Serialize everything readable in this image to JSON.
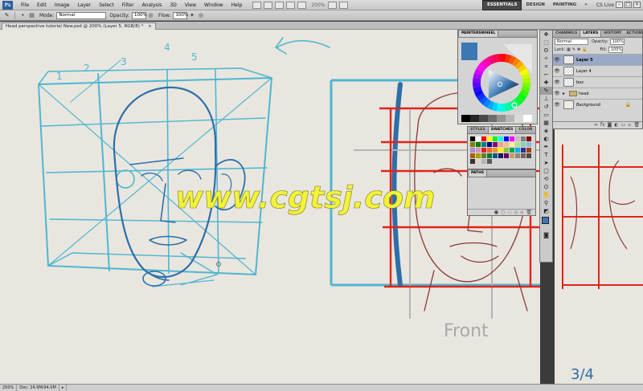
{
  "app": {
    "logo": "Ps",
    "menus": [
      "File",
      "Edit",
      "Image",
      "Layer",
      "Select",
      "Filter",
      "Analysis",
      "3D",
      "View",
      "Window",
      "Help"
    ],
    "zoom": "200%",
    "workspaces": [
      "ESSENTIALS",
      "DESIGN",
      "PAINTING"
    ],
    "cs_live": "CS Live"
  },
  "options": {
    "mode_label": "Mode:",
    "mode_value": "Normal",
    "opacity_label": "Opacity:",
    "opacity_value": "100%",
    "flow_label": "Flow:",
    "flow_value": "100%"
  },
  "document": {
    "tab_title": "Head perspective tutorial New.psd @ 200% (Layer 5, RGB/8) *"
  },
  "canvas_text": {
    "watermark": "www.cgtsj.com",
    "front_label": "Front",
    "three_q_label": "3/4",
    "num_1": "1",
    "num_2": "2",
    "num_3": "3",
    "num_4": "4",
    "num_5": "5"
  },
  "status": {
    "zoom": "200%",
    "doc_size": "Doc: 24.9M/94.0M"
  },
  "painter_panel": {
    "tab": "PAINTERSWHEEL",
    "accent_color": "#3c78b4"
  },
  "swatch_panel": {
    "tabs": [
      "STYLES",
      "SWATCHES",
      "COLOR"
    ],
    "active_tab": "SWATCHES",
    "colors": [
      "#000000",
      "#ffffff",
      "#ff0000",
      "#ffff00",
      "#00ff00",
      "#00ffff",
      "#0000ff",
      "#ff00ff",
      "#c0c0c0",
      "#808080",
      "#800000",
      "#808000",
      "#008000",
      "#008080",
      "#000080",
      "#800080",
      "#f3a08a",
      "#f7c08a",
      "#fff09a",
      "#b8e08a",
      "#8ad0b8",
      "#8ab8e0",
      "#a890d0",
      "#e090c0",
      "#ed1c24",
      "#f26522",
      "#f7941d",
      "#fff200",
      "#8dc63f",
      "#00a651",
      "#00aeef",
      "#2e3192",
      "#a0410d",
      "#a36209",
      "#aba000",
      "#598527",
      "#007236",
      "#005b7f",
      "#1b1464",
      "#630460",
      "#c69c6d",
      "#998675",
      "#736357",
      "#534741",
      "#362f2d",
      "#e0d4c4",
      "#b4b4b4",
      "#5a5a5a"
    ]
  },
  "paths_panel": {
    "tab": "PATHS"
  },
  "layers_panel": {
    "tabs": [
      "CHANNELS",
      "LAYERS",
      "HISTORY",
      "ACTIONS"
    ],
    "active_tab": "LAYERS",
    "blend_mode": "Normal",
    "opacity_label": "Opacity:",
    "opacity_value": "100%",
    "lock_label": "Lock:",
    "fill_label": "Fill:",
    "fill_value": "100%",
    "layers": [
      {
        "name": "Layer 5",
        "kind": "layer",
        "active": true
      },
      {
        "name": "Layer 4",
        "kind": "layer",
        "active": false
      },
      {
        "name": "box",
        "kind": "layer",
        "active": false
      },
      {
        "name": "head",
        "kind": "group",
        "active": false
      },
      {
        "name": "Background",
        "kind": "background",
        "active": false
      }
    ]
  },
  "colors": {
    "sketch_blue": "#4fb6cf",
    "sketch_dark_blue": "#2d6fa8",
    "guide_red": "#e0241b",
    "sketch_brown": "#8a3a34",
    "watermark_yellow": "#f2f23a",
    "canvas_bg": "#e9e6e0"
  }
}
